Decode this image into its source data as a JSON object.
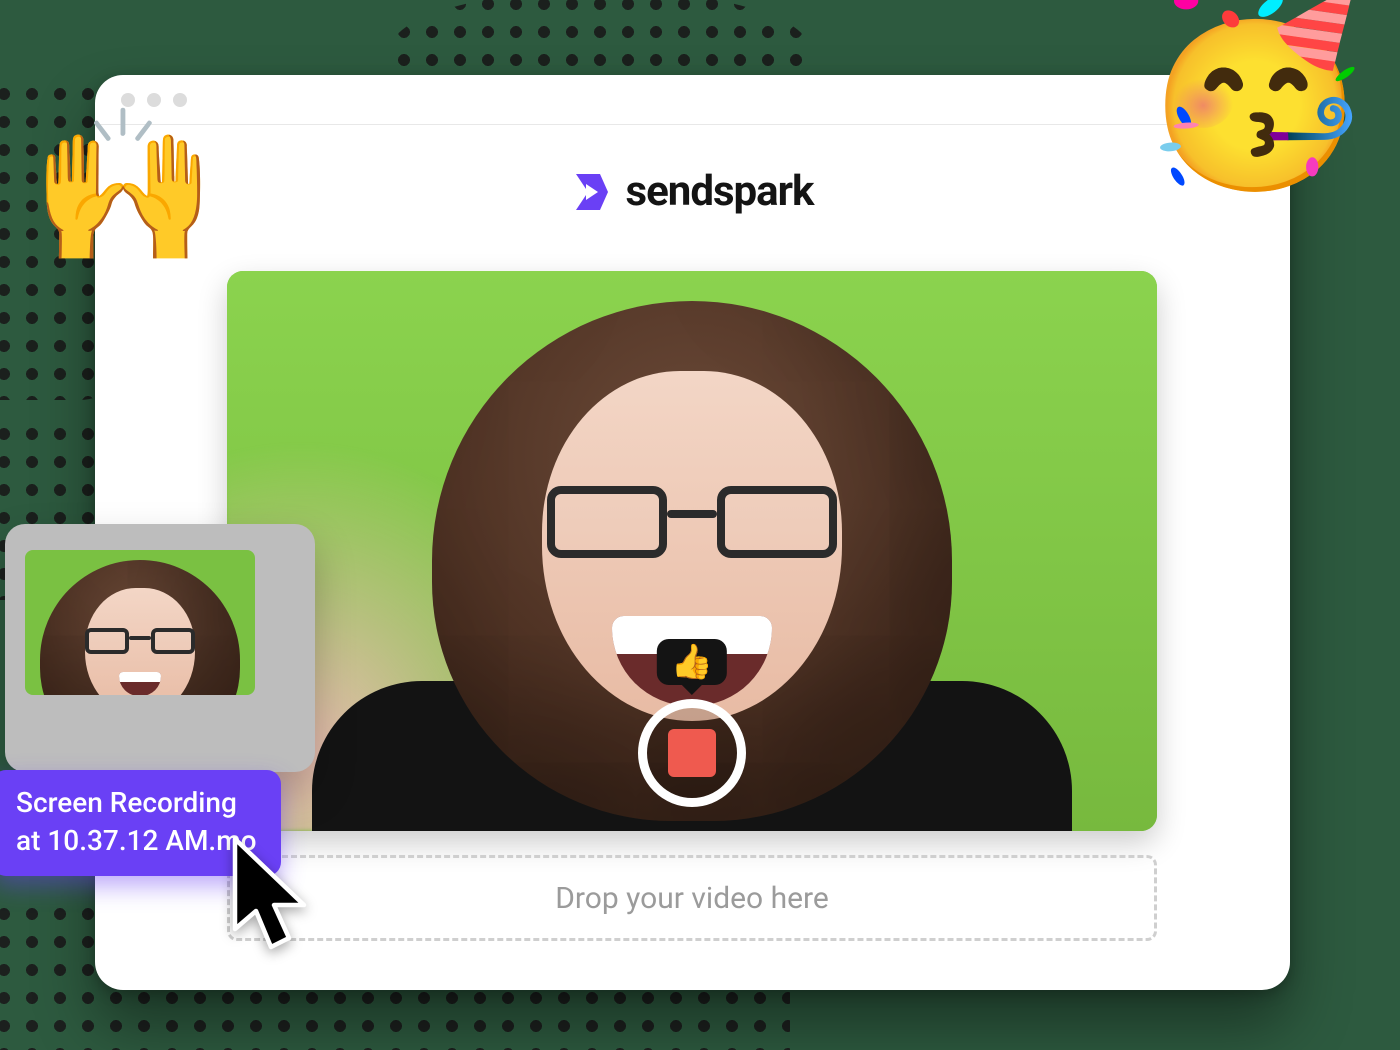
{
  "brand": {
    "name": "sendspark"
  },
  "recorder": {
    "tooltip_emoji": "👍",
    "tooltip_emoji_name": "thumbs-up"
  },
  "dropzone": {
    "label": "Drop your video here"
  },
  "file": {
    "line1": "Screen Recording",
    "line2": "at 10.37.12 AM.mo"
  },
  "decor": {
    "hands_emoji": "🙌",
    "party_emoji": "🥳"
  },
  "colors": {
    "accent": "#6a40f5",
    "record": "#ef5a4f"
  }
}
